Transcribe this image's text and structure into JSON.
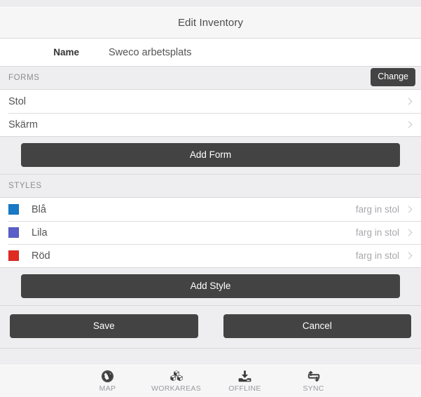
{
  "navbar": {
    "title": "Edit Inventory"
  },
  "detail": {
    "name_label": "Name",
    "name_value": "Sweco arbetsplats"
  },
  "forms_section": {
    "header": "FORMS",
    "change_label": "Change",
    "items": [
      {
        "label": "Stol"
      },
      {
        "label": "Skärm"
      }
    ],
    "add_label": "Add Form"
  },
  "styles_section": {
    "header": "STYLES",
    "items": [
      {
        "label": "Blå",
        "note": "farg in stol",
        "color": "#1879c6"
      },
      {
        "label": "Lila",
        "note": "farg in stol",
        "color": "#5a5ec8"
      },
      {
        "label": "Röd",
        "note": "farg in stol",
        "color": "#e02b22"
      }
    ],
    "add_label": "Add Style"
  },
  "actions": {
    "save_label": "Save",
    "cancel_label": "Cancel"
  },
  "tabbar": {
    "tabs": [
      {
        "label": "MAP",
        "icon": "globe-icon"
      },
      {
        "label": "WORKAREAS",
        "icon": "cubes-icon"
      },
      {
        "label": "OFFLINE",
        "icon": "download-icon"
      },
      {
        "label": "SYNC",
        "icon": "sync-icon"
      }
    ]
  },
  "theme": {
    "button_dark": "#434343",
    "page_bg": "#eeeef0",
    "bar_bg": "#f6f6f7"
  }
}
